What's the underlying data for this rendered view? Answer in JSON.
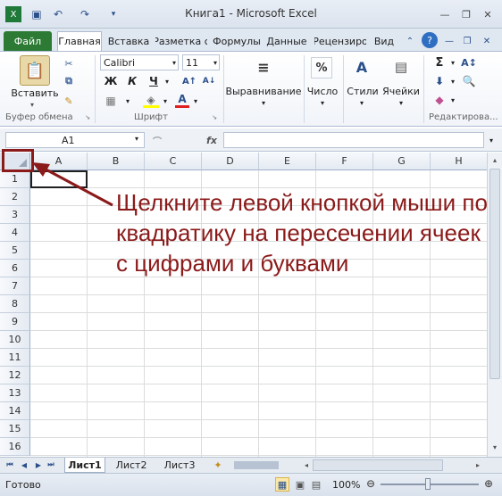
{
  "window": {
    "title": "Книга1  -  Microsoft Excel",
    "quick_access": [
      "save-icon",
      "undo-icon",
      "redo-icon",
      "customize-icon"
    ],
    "controls": [
      "minimize-icon",
      "restore-icon",
      "close-icon"
    ]
  },
  "tabs": [
    "Файл",
    "Главная",
    "Вставка",
    "Разметка с",
    "Формулы",
    "Данные",
    "Рецензиро",
    "Вид"
  ],
  "ribbon": {
    "clipboard": {
      "paste_label": "Вставить",
      "group_label": "Буфер обмена"
    },
    "font": {
      "font_name": "Calibri",
      "font_size": "11",
      "bold": "Ж",
      "italic": "К",
      "underline": "Ч",
      "group_label": "Шрифт"
    },
    "alignment_label": "Выравнивание",
    "number_label": "Число",
    "number_icon": "%",
    "styles_label": "Стили",
    "cells_label": "Ячейки",
    "editing_label": "Редактирова...",
    "sum_icon": "Σ"
  },
  "formula_bar": {
    "name_box": "A1",
    "fx": "fx",
    "value": ""
  },
  "columns": [
    "A",
    "B",
    "C",
    "D",
    "E",
    "F",
    "G",
    "H"
  ],
  "rows": [
    "1",
    "2",
    "3",
    "4",
    "5",
    "6",
    "7",
    "8",
    "9",
    "10",
    "11",
    "12",
    "13",
    "14",
    "15",
    "16"
  ],
  "sheets": [
    "Лист1",
    "Лист2",
    "Лист3"
  ],
  "status": {
    "ready": "Готово",
    "zoom": "100%"
  },
  "annotation": {
    "text": "Щелкните левой кнопкой мыши по квадратику на пересечении ячеек с цифрами и буквами",
    "color": "#8b1a1a"
  }
}
